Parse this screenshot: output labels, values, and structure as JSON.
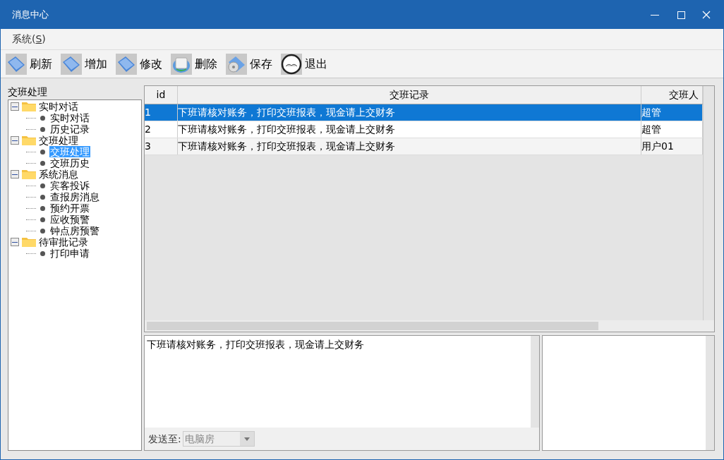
{
  "window": {
    "title": "消息中心"
  },
  "menu": [
    {
      "label": "系统(",
      "mnemonic": "S",
      "tail": ")"
    }
  ],
  "toolbar": [
    {
      "label": "刷新",
      "kind": "folder"
    },
    {
      "label": "增加",
      "kind": "folder"
    },
    {
      "label": "修改",
      "kind": "folder"
    },
    {
      "label": "删除",
      "kind": "disk"
    },
    {
      "label": "保存",
      "kind": "cd"
    },
    {
      "label": "退出",
      "kind": "book"
    }
  ],
  "tree": {
    "title": "交班处理",
    "items": [
      {
        "label": "实时对话",
        "expanded": true,
        "children": [
          {
            "label": "实时对话",
            "selected": false
          },
          {
            "label": "历史记录",
            "selected": false
          }
        ]
      },
      {
        "label": "交班处理",
        "expanded": true,
        "children": [
          {
            "label": "交班处理",
            "selected": true
          },
          {
            "label": "交班历史",
            "selected": false
          }
        ]
      },
      {
        "label": "系统消息",
        "expanded": true,
        "children": [
          {
            "label": "宾客投诉",
            "selected": false
          },
          {
            "label": "查报房消息",
            "selected": false
          },
          {
            "label": "预约开票",
            "selected": false
          },
          {
            "label": "应收预警",
            "selected": false
          },
          {
            "label": "钟点房预警",
            "selected": false
          }
        ]
      },
      {
        "label": "待审批记录",
        "expanded": true,
        "children": [
          {
            "label": "打印申请",
            "selected": false
          }
        ]
      }
    ]
  },
  "table": {
    "columns": [
      "id",
      "交班记录",
      "交班人"
    ],
    "rows": [
      {
        "cells": [
          "1",
          "下班请核对账务，打印交班报表，现金请上交财务",
          "超管"
        ],
        "selected": true
      },
      {
        "cells": [
          "2",
          "下班请核对账务，打印交班报表，现金请上交财务",
          "超管"
        ],
        "selected": false
      },
      {
        "cells": [
          "3",
          "下班请核对账务，打印交班报表，现金请上交财务",
          "用户01"
        ],
        "selected": false
      }
    ]
  },
  "detail": {
    "text": "下班请核对账务，打印交班报表，现金请上交财务",
    "send_label": "发送至:",
    "send_value": "电脑房"
  }
}
